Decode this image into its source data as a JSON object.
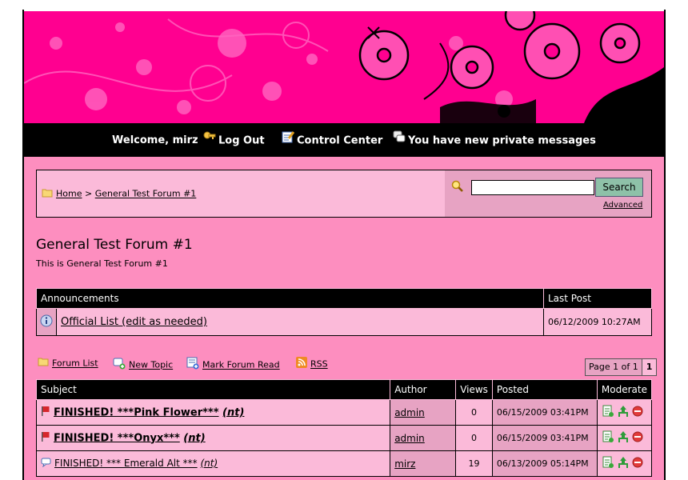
{
  "nav": {
    "welcome": "Welcome, mirz",
    "logout": "Log Out",
    "control_center": "Control Center",
    "private_messages": "You have new private messages"
  },
  "breadcrumb": {
    "home": "Home",
    "separator": ">",
    "forum": "General Test Forum #1"
  },
  "search": {
    "button": "Search",
    "input_value": "",
    "advanced": "Advanced"
  },
  "forum": {
    "title": "General Test Forum #1",
    "description": "This is General Test Forum #1"
  },
  "announcements": {
    "headers": [
      "Announcements",
      "Last Post"
    ],
    "rows": [
      {
        "title": "Official List (edit as needed)",
        "last_post": "06/12/2009 10:27AM"
      }
    ]
  },
  "forum_nav": {
    "forum_list": "Forum List",
    "new_topic": "New Topic",
    "mark_read": "Mark Forum Read",
    "rss": "RSS"
  },
  "pager": {
    "label": "Page 1 of 1",
    "current": "1"
  },
  "topics": {
    "headers": [
      "Subject",
      "Author",
      "Views",
      "Posted",
      "Moderate"
    ],
    "rows": [
      {
        "subject": "FINISHED! ***Pink Flower***",
        "suffix": "(nt)",
        "author": "admin",
        "views": "0",
        "posted": "06/15/2009 03:41PM",
        "unread": true
      },
      {
        "subject": "FINISHED! ***Onyx***",
        "suffix": "(nt)",
        "author": "admin",
        "views": "0",
        "posted": "06/15/2009 03:41PM",
        "unread": true
      },
      {
        "subject": "FINISHED! *** Emerald Alt ***",
        "suffix": "(nt)",
        "author": "mirz",
        "views": "19",
        "posted": "06/13/2009 05:14PM",
        "unread": false
      }
    ]
  },
  "colors": {
    "banner": "#ff0090",
    "content_bg": "#fd8ebf",
    "cell_light": "#fbbad9",
    "cell_dark": "#e7a3c3",
    "header_bg": "#000000"
  }
}
